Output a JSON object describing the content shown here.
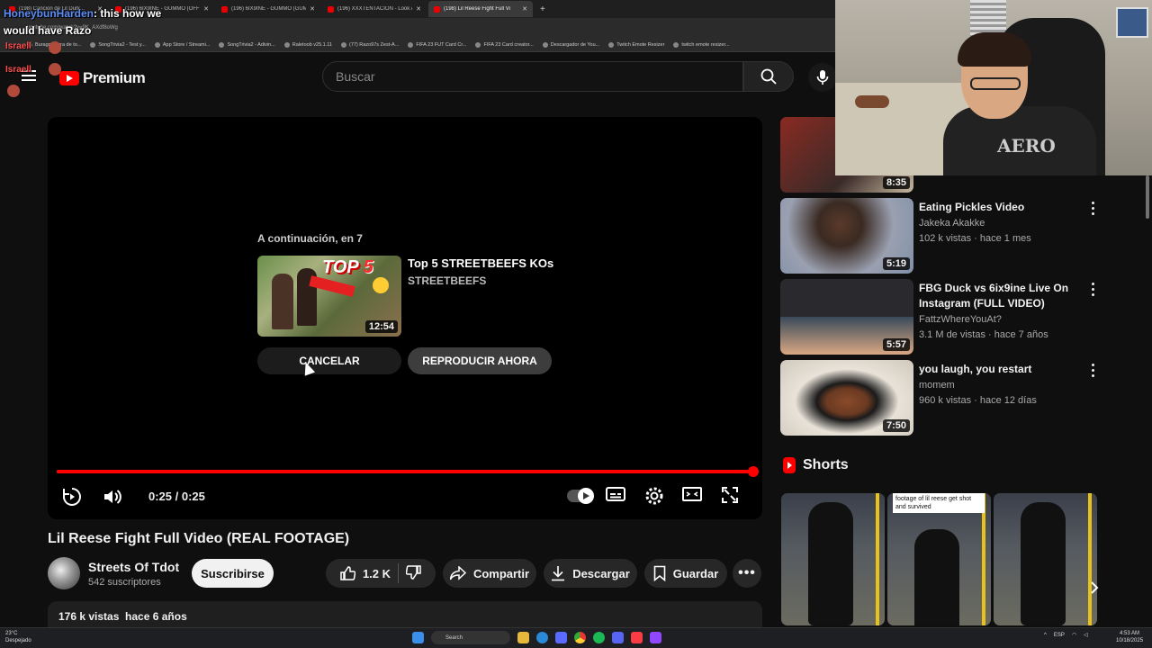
{
  "browser": {
    "tabs": [
      {
        "label": "(198) Cancion de Lil Durk...",
        "active": false
      },
      {
        "label": "(196) 6IX9INE - GUMMO (OFFI",
        "active": false
      },
      {
        "label": "(196) 6IX9INE - GUMMO (GUM",
        "active": false
      },
      {
        "label": "(196) XXXTENTACION - Look At",
        "active": false
      },
      {
        "label": "(198) Lil Reese Fight Full Vi",
        "active": true
      }
    ],
    "url": "youtube.com/watch?v=9K_AXdf8oWg",
    "bookmarks": [
      "Burago figura de to...",
      "SongTrivia2 - Test y...",
      "App Store / Streami...",
      "SongTrivia2 - Adivin...",
      "Raletoob v25.1.11",
      "(77) Razo97s Zest-A...",
      "FIFA 23 FUT Card Cr...",
      "FIFA 23 Card creator...",
      "Descargador de You...",
      "Twitch Emote Resizer",
      "twitch emote resizer..."
    ]
  },
  "chat": {
    "username": "HoneybunHarden",
    "message_line1": ": this how we",
    "message_line2": "would have Razo",
    "name2": "Israell",
    "name3": "Israell"
  },
  "header": {
    "brand": "Premium",
    "search_placeholder": "Buscar"
  },
  "player": {
    "upnext_label": "A continuación, en 7",
    "upnext_video_title": "Top 5 STREETBEEFS KOs",
    "upnext_channel": "STREETBEEFS",
    "upnext_thumb_text": "TOP",
    "upnext_thumb_number": "5",
    "upnext_duration": "12:54",
    "cancel_label": "CANCELAR",
    "play_now_label": "REPRODUCIR AHORA",
    "time": "0:25 / 0:25",
    "progress": 1.0
  },
  "video": {
    "title": "Lil Reese Fight Full Video (REAL FOOTAGE)",
    "channel": "Streets Of Tdot",
    "subscribers": "542 suscriptores",
    "subscribe_label": "Suscribirse",
    "likes": "1.2 K",
    "share_label": "Compartir",
    "download_label": "Descargar",
    "save_label": "Guardar",
    "views_date": "176 k vistas  hace 6 años"
  },
  "recommendations": [
    {
      "title": "",
      "channel": "",
      "meta": "",
      "duration": "8:35",
      "thumb": "#8a2a22"
    },
    {
      "title": "Eating Pickles Video",
      "channel": "Jakeka Akakke",
      "meta": "102 k vistas · hace 1 mes",
      "duration": "5:19",
      "thumb": "#6a5a4a"
    },
    {
      "title": "FBG Duck vs 6ix9ine Live On Instagram (FULL VIDEO)",
      "channel": "FattzWhereYouAt?",
      "meta": "3.1 M de vistas · hace 7 años",
      "duration": "5:57",
      "thumb": "#4a4a52"
    },
    {
      "title": "you laugh, you restart",
      "channel": "momem",
      "meta": "960 k vistas · hace 12 días",
      "duration": "7:50",
      "thumb": "#c9c2b6"
    }
  ],
  "shorts": {
    "title": "Shorts",
    "items": [
      {
        "caption": ""
      },
      {
        "caption": "footage of lil reese get shot and survived"
      },
      {
        "caption": ""
      }
    ]
  },
  "webcam": {
    "shirt_text": "AERO"
  },
  "taskbar": {
    "temp": "23°C",
    "weather": "Despejado",
    "search": "Search",
    "lang": "ESP",
    "time": "4:53 AM",
    "date": "10/18/2025"
  },
  "colors": {
    "accent": "#ff0000",
    "bg": "#0f0f0f"
  }
}
